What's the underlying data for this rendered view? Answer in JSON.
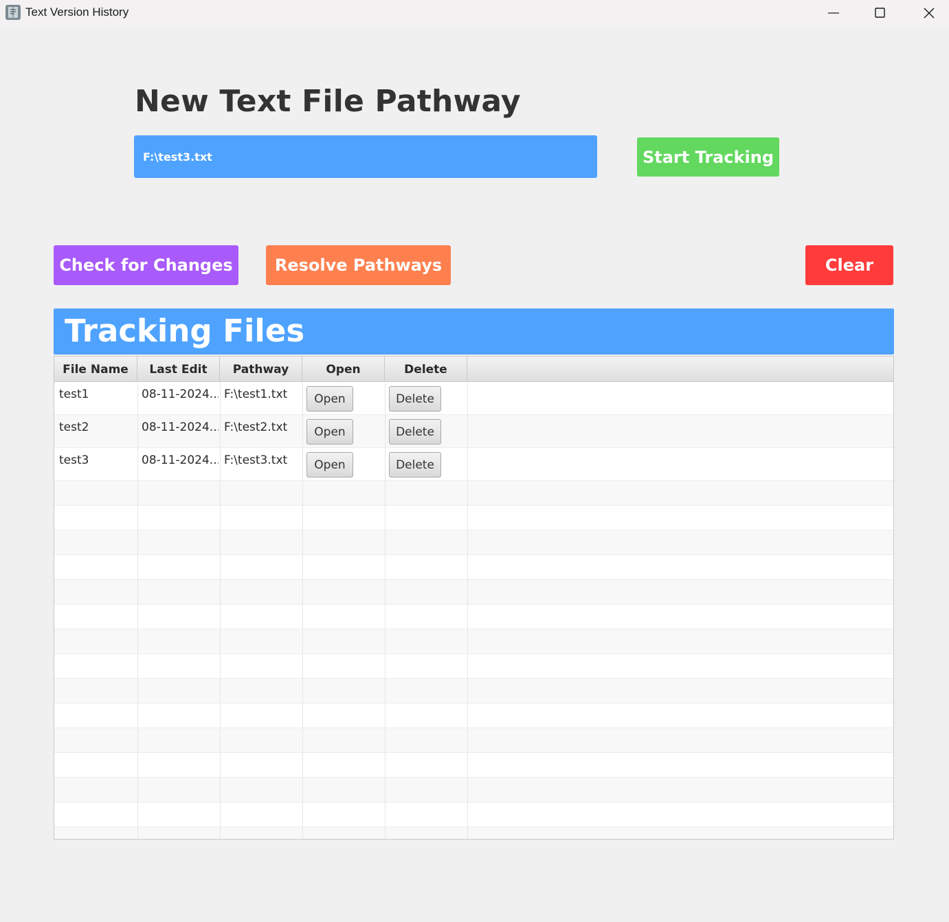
{
  "window": {
    "title": "Text Version History",
    "controls": [
      "minimize-icon",
      "maximize-icon",
      "close-icon"
    ]
  },
  "form": {
    "heading": "New Text File Pathway",
    "path_value": "F:\\test3.txt",
    "start_label": "Start Tracking"
  },
  "actions": {
    "check_label": "Check for Changes",
    "resolve_label": "Resolve Pathways",
    "clear_label": "Clear"
  },
  "tracking": {
    "title": "Tracking Files",
    "columns": [
      "File Name",
      "Last Edit",
      "Pathway",
      "Open",
      "Delete"
    ],
    "rows": [
      {
        "name": "test1",
        "last_edit": "08-11-2024...",
        "pathway": "F:\\test1.txt",
        "open": "Open",
        "delete": "Delete"
      },
      {
        "name": "test2",
        "last_edit": "08-11-2024...",
        "pathway": "F:\\test2.txt",
        "open": "Open",
        "delete": "Delete"
      },
      {
        "name": "test3",
        "last_edit": "08-11-2024...",
        "pathway": "F:\\test3.txt",
        "open": "Open",
        "delete": "Delete"
      }
    ]
  },
  "colors": {
    "input_bg": "#4fa3ff",
    "start": "#63d85f",
    "check": "#a95afa",
    "resolve": "#fe804f",
    "clear": "#ff3b3b",
    "banner": "#4fa3ff"
  }
}
